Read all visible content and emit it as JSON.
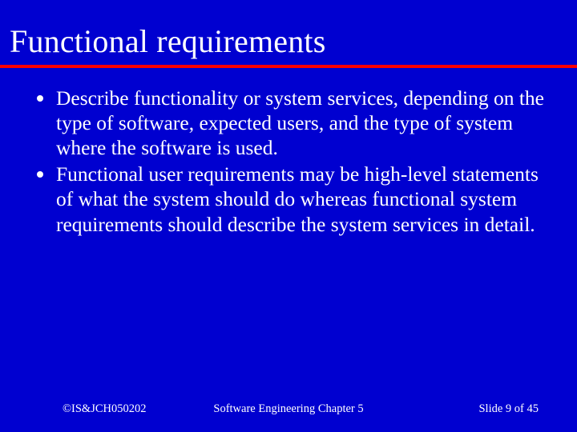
{
  "title": "Functional requirements",
  "bullets": [
    "Describe functionality or system services, depending on the type of software, expected users, and the type of system where the software is used.",
    "Functional user requirements may be high-level statements of what the system should do whereas functional system requirements should describe the system services in detail."
  ],
  "footer": {
    "left": "©IS&JCH050202",
    "center": "Software Engineering Chapter 5",
    "right": "Slide  9 of 45"
  }
}
